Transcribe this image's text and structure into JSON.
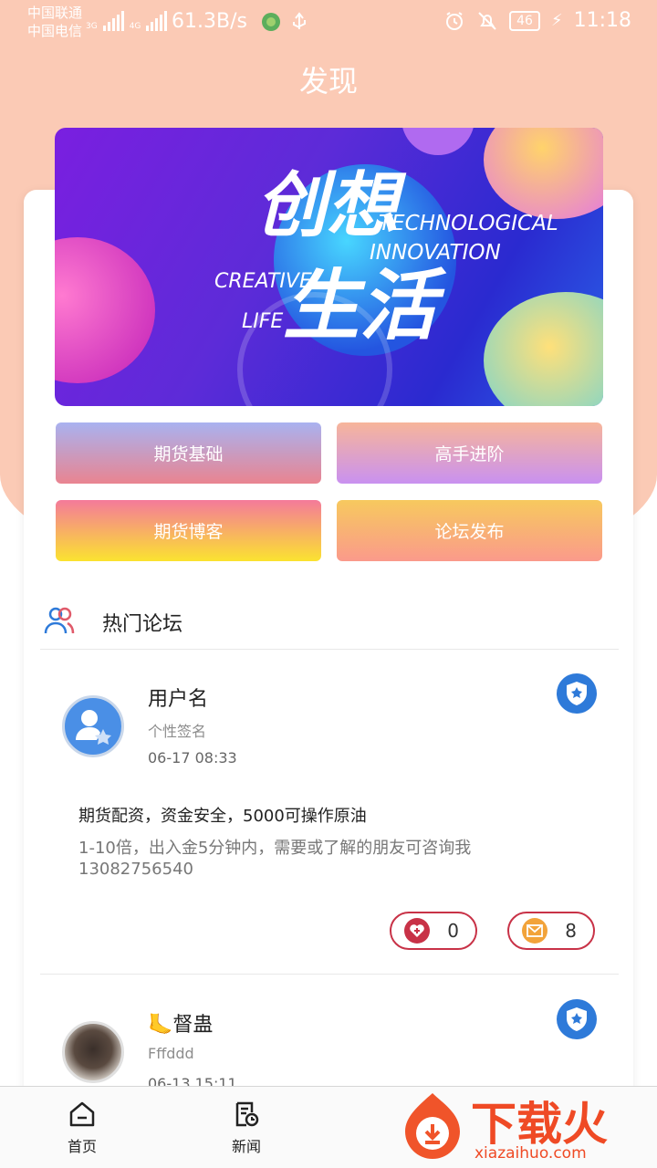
{
  "status_bar": {
    "carrier_1": "中国联通",
    "carrier_2": "中国电信",
    "net_1": "3G",
    "net_2": "4G",
    "speed": "61.3B/s",
    "battery": "46",
    "time": "11:18"
  },
  "header": {
    "title": "发现"
  },
  "banner": {
    "main_text_1": "创想",
    "main_text_2": "生活",
    "en_1": "TECHNOLOGICAL",
    "en_2": "INNOVATION",
    "en_3": "CREATIVE",
    "en_4": "LIFE"
  },
  "quick_links": [
    {
      "label": "期货基础"
    },
    {
      "label": "高手进阶"
    },
    {
      "label": "期货博客"
    },
    {
      "label": "论坛发布"
    }
  ],
  "section": {
    "title": "热门论坛"
  },
  "posts": [
    {
      "username": "用户名",
      "signature": "个性签名",
      "time": "06-17 08:33",
      "title": "期货配资，资金安全，5000可操作原油",
      "body": "1-10倍，出入金5分钟内，需要或了解的朋友可咨询我13082756540",
      "likes": "0",
      "messages": "8"
    },
    {
      "username": "🦶督蛊",
      "signature": "Fffddd",
      "time": "06-13 15:11"
    }
  ],
  "tabbar": {
    "home": "首页",
    "news": "新闻"
  },
  "watermark": {
    "brand": "下载火",
    "url": "xiazaihuo.com"
  },
  "colors": {
    "header_bg": "#fbcab5",
    "accent_red": "#c83247",
    "shield_blue": "#2e7ad9"
  }
}
